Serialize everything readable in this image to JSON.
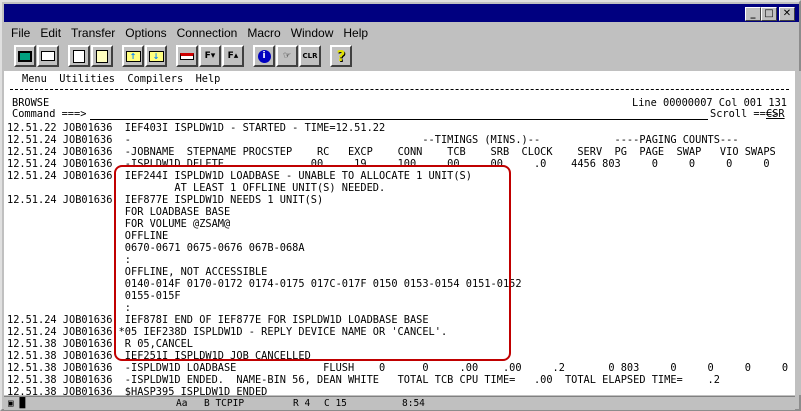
{
  "window": {
    "title": "",
    "buttons": [
      "_",
      "□",
      "✕"
    ]
  },
  "menu": [
    "File",
    "Edit",
    "Transfer",
    "Options",
    "Connection",
    "Macro",
    "Window",
    "Help"
  ],
  "toolbar": [
    "display-icon",
    "print-icon",
    "copy-icon",
    "paste-icon",
    "send-file-icon",
    "receive-file-icon",
    "keyboard-map-icon",
    "font-smaller-icon",
    "font-larger-icon",
    "info-icon",
    "point-icon",
    "clear-icon",
    "help-icon"
  ],
  "toolbar_labels": {
    "font_down": "F▾",
    "font_up": "F▴",
    "clr": "CLR",
    "help": "?",
    "info": "i"
  },
  "ispf_menu": "Menu  Utilities  Compilers  Help",
  "browse": "BROWSE",
  "position": "Line 00000007 Col 001 131",
  "command_label": "Command ===> ",
  "scroll_label": "Scroll ===> ",
  "scroll_value": "CSR",
  "lines": [
    {
      "t": "12.51.22 JOB01636  ",
      "m": "IEF403I ISPLDW1D - STARTED - TIME=12.51.22"
    },
    {
      "t": "12.51.24 JOB01636  ",
      "m": "-                                               --TIMINGS (MINS.)--            ----PAGING COUNTS---"
    },
    {
      "t": "12.51.24 JOB01636  ",
      "m": "-JOBNAME  STEPNAME PROCSTEP    RC   EXCP    CONN    TCB    SRB  CLOCK    SERV  PG  PAGE  SWAP   VIO SWAPS"
    },
    {
      "t": "12.51.24 JOB01636  ",
      "m": "-ISPLDW1D DELETE              00     19     100    .00    .00     .0    4456 803     0     0     0     0"
    },
    {
      "t": "12.51.24 JOB01636  ",
      "m": "IEF244I ISPLDW1D LOADBASE - UNABLE TO ALLOCATE 1 UNIT(S)"
    },
    {
      "t": "                   ",
      "m": "        AT LEAST 1 OFFLINE UNIT(S) NEEDED."
    },
    {
      "t": "12.51.24 JOB01636  ",
      "m": "IEF877E ISPLDW1D NEEDS 1 UNIT(S)"
    },
    {
      "t": "                   ",
      "m": "FOR LOADBASE BASE"
    },
    {
      "t": "                   ",
      "m": "FOR VOLUME @ZSAM@"
    },
    {
      "t": "                   ",
      "m": "OFFLINE"
    },
    {
      "t": "                   ",
      "m": "0670-0671 0675-0676 067B-068A"
    },
    {
      "t": "                   ",
      "m": ":"
    },
    {
      "t": "                   ",
      "m": "OFFLINE, NOT ACCESSIBLE"
    },
    {
      "t": "                   ",
      "m": "0140-014F 0170-0172 0174-0175 017C-017F 0150 0153-0154 0151-0152"
    },
    {
      "t": "                   ",
      "m": "0155-015F"
    },
    {
      "t": "                   ",
      "m": ":"
    },
    {
      "t": "12.51.24 JOB01636  ",
      "m": "IEF878I END OF IEF877E FOR ISPLDW1D LOADBASE BASE"
    },
    {
      "t": "12.51.24 JOB01636 ",
      "m": "*05 IEF238D ISPLDW1D - REPLY DEVICE NAME OR 'CANCEL'."
    },
    {
      "t": "12.51.38 JOB01636  ",
      "m": "R 05,CANCEL"
    },
    {
      "t": "12.51.38 JOB01636  ",
      "m": "IEF251I ISPLDW1D JOB CANCELLED"
    },
    {
      "t": "12.51.38 JOB01636  ",
      "m": "-ISPLDW1D LOADBASE              FLUSH    0      0     .00    .00     .2       0 803     0     0     0     0"
    },
    {
      "t": "12.51.38 JOB01636  ",
      "m": "-ISPLDW1D ENDED.  NAME-BIN 56, DEAN WHITE   TOTAL TCB CPU TIME=   .00  TOTAL ELAPSED TIME=    .2"
    },
    {
      "t": "12.51.38 JOB01636  ",
      "m": "$HASP395 ISPLDW1D ENDED"
    }
  ],
  "status": {
    "indicator": "▣ █",
    "mode": "Aa",
    "session": "B TCPIP",
    "row": "R 4",
    "col": "C 15",
    "time": "8:54"
  }
}
